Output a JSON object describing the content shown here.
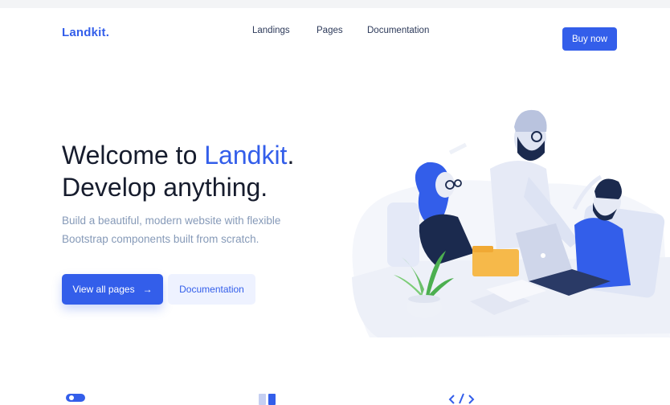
{
  "nav": {
    "logo": "Landkit.",
    "links": [
      "Landings",
      "Pages",
      "Documentation"
    ],
    "buy_label": "Buy now"
  },
  "hero": {
    "title_prefix": "Welcome to ",
    "title_accent": "Landkit",
    "title_suffix": ".",
    "title_line2": "Develop anything.",
    "lead_line1": "Build a beautiful, modern website with flexible",
    "lead_line2": "Bootstrap components built from scratch.",
    "primary_button": "View all pages",
    "primary_arrow": "→",
    "secondary_button": "Documentation"
  },
  "features": {
    "icons": [
      "toggle-icon",
      "layout-icon",
      "code-icon"
    ]
  },
  "colors": {
    "primary": "#335eea",
    "primary_soft": "#eef2ff",
    "text": "#161c2d",
    "muted": "#869ab8"
  }
}
